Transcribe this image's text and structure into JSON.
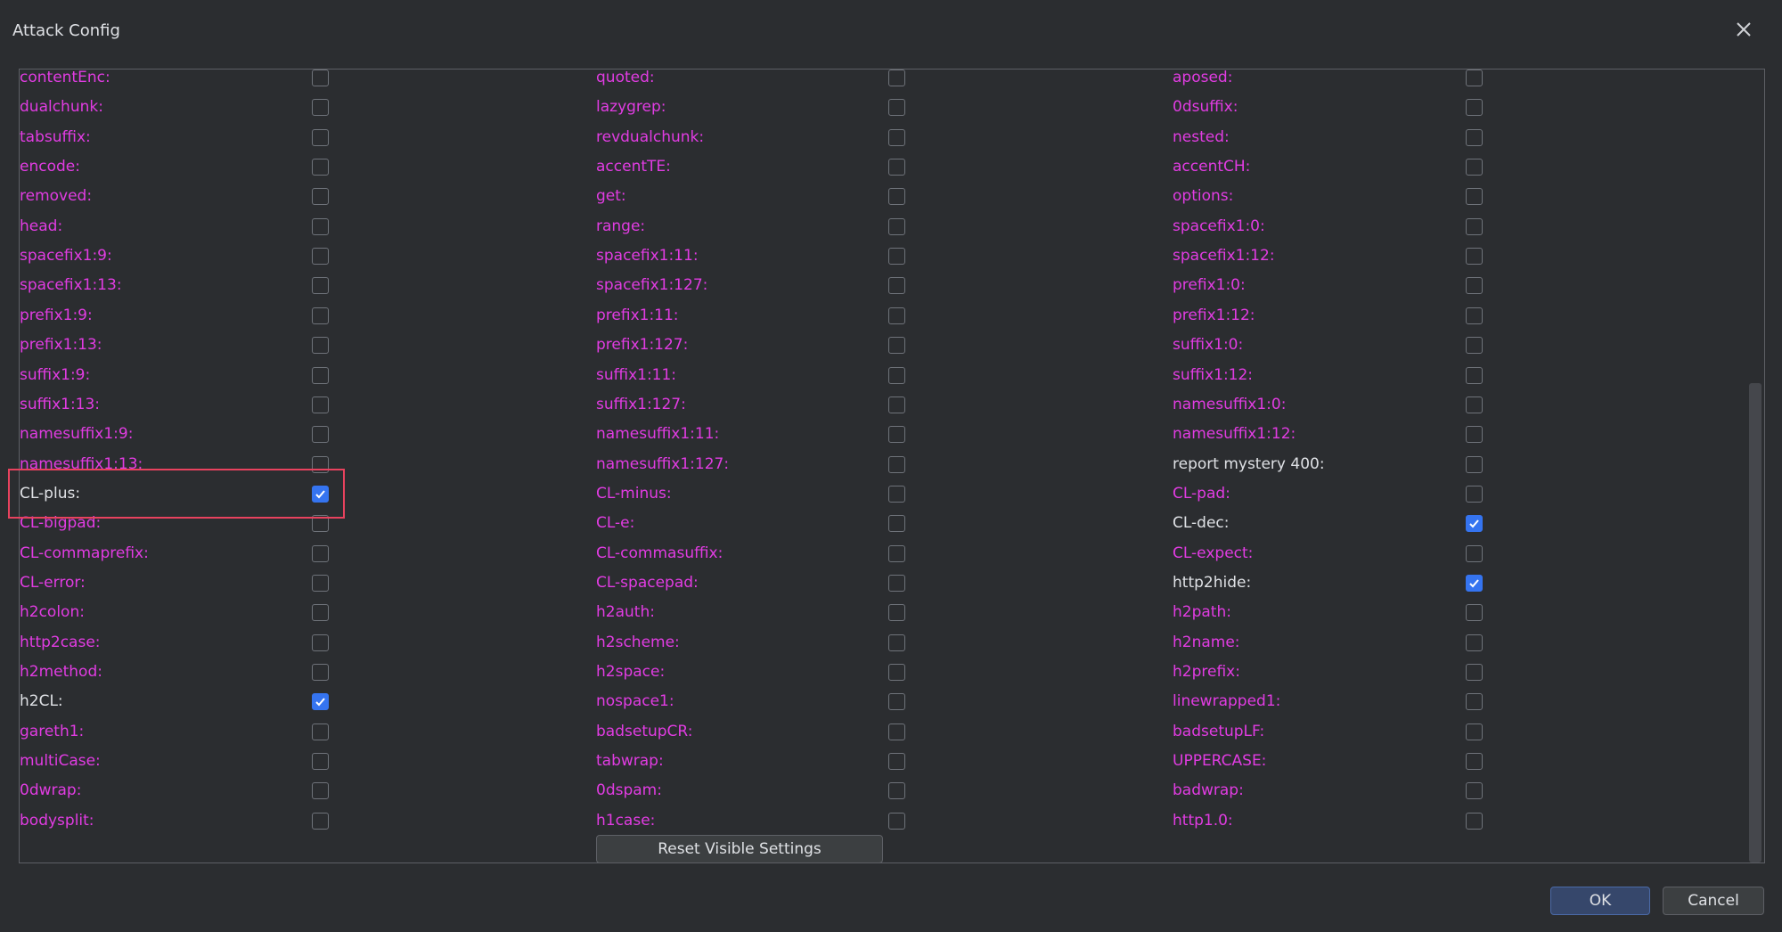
{
  "window": {
    "title": "Attack Config"
  },
  "columns": [
    {
      "items": [
        {
          "label": "contentEnc:",
          "checked": false
        },
        {
          "label": "dualchunk:",
          "checked": false
        },
        {
          "label": "tabsuffix:",
          "checked": false
        },
        {
          "label": "encode:",
          "checked": false
        },
        {
          "label": "removed:",
          "checked": false
        },
        {
          "label": "head:",
          "checked": false
        },
        {
          "label": "spacefix1:9:",
          "checked": false
        },
        {
          "label": "spacefix1:13:",
          "checked": false
        },
        {
          "label": "prefix1:9:",
          "checked": false
        },
        {
          "label": "prefix1:13:",
          "checked": false
        },
        {
          "label": "suffix1:9:",
          "checked": false
        },
        {
          "label": "suffix1:13:",
          "checked": false
        },
        {
          "label": "namesuffix1:9:",
          "checked": false
        },
        {
          "label": "namesuffix1:13:",
          "checked": false
        },
        {
          "label": "CL-plus:",
          "checked": true
        },
        {
          "label": "CL-bigpad:",
          "checked": false
        },
        {
          "label": "CL-commaprefix:",
          "checked": false
        },
        {
          "label": "CL-error:",
          "checked": false
        },
        {
          "label": "h2colon:",
          "checked": false
        },
        {
          "label": "http2case:",
          "checked": false
        },
        {
          "label": "h2method:",
          "checked": false
        },
        {
          "label": "h2CL:",
          "checked": true
        },
        {
          "label": "gareth1:",
          "checked": false
        },
        {
          "label": "multiCase:",
          "checked": false
        },
        {
          "label": "0dwrap:",
          "checked": false
        },
        {
          "label": "bodysplit:",
          "checked": false
        }
      ]
    },
    {
      "items": [
        {
          "label": "quoted:",
          "checked": false
        },
        {
          "label": "lazygrep:",
          "checked": false
        },
        {
          "label": "revdualchunk:",
          "checked": false
        },
        {
          "label": "accentTE:",
          "checked": false
        },
        {
          "label": "get:",
          "checked": false
        },
        {
          "label": "range:",
          "checked": false
        },
        {
          "label": "spacefix1:11:",
          "checked": false
        },
        {
          "label": "spacefix1:127:",
          "checked": false
        },
        {
          "label": "prefix1:11:",
          "checked": false
        },
        {
          "label": "prefix1:127:",
          "checked": false
        },
        {
          "label": "suffix1:11:",
          "checked": false
        },
        {
          "label": "suffix1:127:",
          "checked": false
        },
        {
          "label": "namesuffix1:11:",
          "checked": false
        },
        {
          "label": "namesuffix1:127:",
          "checked": false
        },
        {
          "label": "CL-minus:",
          "checked": false
        },
        {
          "label": "CL-e:",
          "checked": false
        },
        {
          "label": "CL-commasuffix:",
          "checked": false
        },
        {
          "label": "CL-spacepad:",
          "checked": false
        },
        {
          "label": "h2auth:",
          "checked": false
        },
        {
          "label": "h2scheme:",
          "checked": false
        },
        {
          "label": "h2space:",
          "checked": false
        },
        {
          "label": "nospace1:",
          "checked": false
        },
        {
          "label": "badsetupCR:",
          "checked": false
        },
        {
          "label": "tabwrap:",
          "checked": false
        },
        {
          "label": "0dspam:",
          "checked": false
        },
        {
          "label": "h1case:",
          "checked": false
        }
      ]
    },
    {
      "items": [
        {
          "label": "aposed:",
          "checked": false
        },
        {
          "label": "0dsuffix:",
          "checked": false
        },
        {
          "label": "nested:",
          "checked": false
        },
        {
          "label": "accentCH:",
          "checked": false
        },
        {
          "label": "options:",
          "checked": false
        },
        {
          "label": "spacefix1:0:",
          "checked": false
        },
        {
          "label": "spacefix1:12:",
          "checked": false
        },
        {
          "label": "prefix1:0:",
          "checked": false
        },
        {
          "label": "prefix1:12:",
          "checked": false
        },
        {
          "label": "suffix1:0:",
          "checked": false
        },
        {
          "label": "suffix1:12:",
          "checked": false
        },
        {
          "label": "namesuffix1:0:",
          "checked": false
        },
        {
          "label": "namesuffix1:12:",
          "checked": false
        },
        {
          "label": "report mystery 400:",
          "checked": false,
          "neutral": true
        },
        {
          "label": "CL-pad:",
          "checked": false
        },
        {
          "label": "CL-dec:",
          "checked": true
        },
        {
          "label": "CL-expect:",
          "checked": false
        },
        {
          "label": "http2hide:",
          "checked": true
        },
        {
          "label": "h2path:",
          "checked": false
        },
        {
          "label": "h2name:",
          "checked": false
        },
        {
          "label": "h2prefix:",
          "checked": false
        },
        {
          "label": "linewrapped1:",
          "checked": false
        },
        {
          "label": "badsetupLF:",
          "checked": false
        },
        {
          "label": "UPPERCASE:",
          "checked": false
        },
        {
          "label": "badwrap:",
          "checked": false
        },
        {
          "label": "http1.0:",
          "checked": false
        }
      ]
    }
  ],
  "buttons": {
    "reset": "Reset Visible Settings",
    "ok": "OK",
    "cancel": "Cancel"
  },
  "colors": {
    "unset_label": "#e13ce2",
    "set_label": "#dfe1e5",
    "checked_box": "#3574f0",
    "highlight": "#e8425e"
  }
}
